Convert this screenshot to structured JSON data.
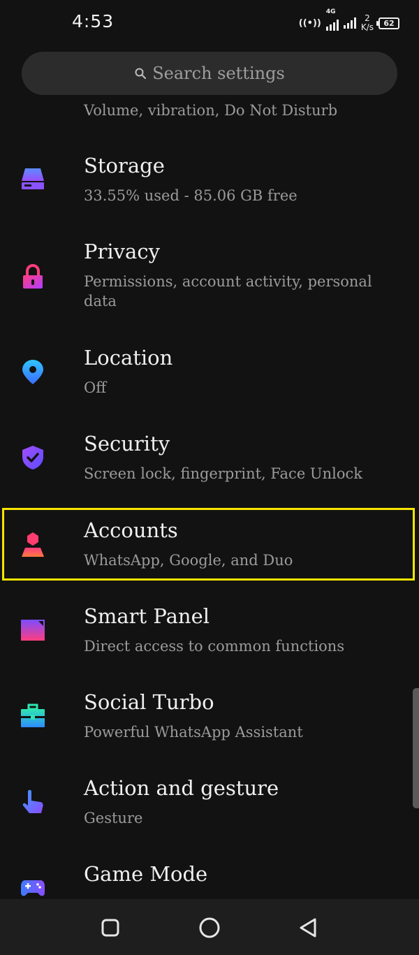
{
  "status_bar": {
    "time": "4:53",
    "network_type": "4G",
    "speed_value": "2",
    "speed_unit": "K/s",
    "battery": "62"
  },
  "search": {
    "placeholder": "Search settings"
  },
  "settings_items": [
    {
      "title": "",
      "subtitle": "Volume, vibration, Do Not Disturb",
      "icon": "sound-icon"
    },
    {
      "title": "Storage",
      "subtitle": "33.55% used - 85.06 GB free",
      "icon": "storage-icon"
    },
    {
      "title": "Privacy",
      "subtitle": "Permissions, account activity, personal data",
      "icon": "privacy-lock-icon"
    },
    {
      "title": "Location",
      "subtitle": "Off",
      "icon": "location-pin-icon"
    },
    {
      "title": "Security",
      "subtitle": "Screen lock, fingerprint, Face Unlock",
      "icon": "security-shield-icon"
    },
    {
      "title": "Accounts",
      "subtitle": "WhatsApp, Google, and Duo",
      "icon": "accounts-person-icon",
      "highlighted": true
    },
    {
      "title": "Smart Panel",
      "subtitle": "Direct access to common functions",
      "icon": "smart-panel-icon"
    },
    {
      "title": "Social Turbo",
      "subtitle": "Powerful WhatsApp Assistant",
      "icon": "social-turbo-briefcase-icon"
    },
    {
      "title": "Action and gesture",
      "subtitle": "Gesture",
      "icon": "gesture-hand-icon"
    },
    {
      "title": "Game Mode",
      "subtitle": "",
      "icon": "game-controller-icon"
    }
  ],
  "colors": {
    "background": "#121212",
    "highlight_border": "#f7e500",
    "icon_gradient_start": "#ff3d7f",
    "icon_gradient_end": "#7b4dff"
  },
  "navigation_bar": [
    "recents-square-icon",
    "home-circle-icon",
    "back-triangle-icon"
  ]
}
